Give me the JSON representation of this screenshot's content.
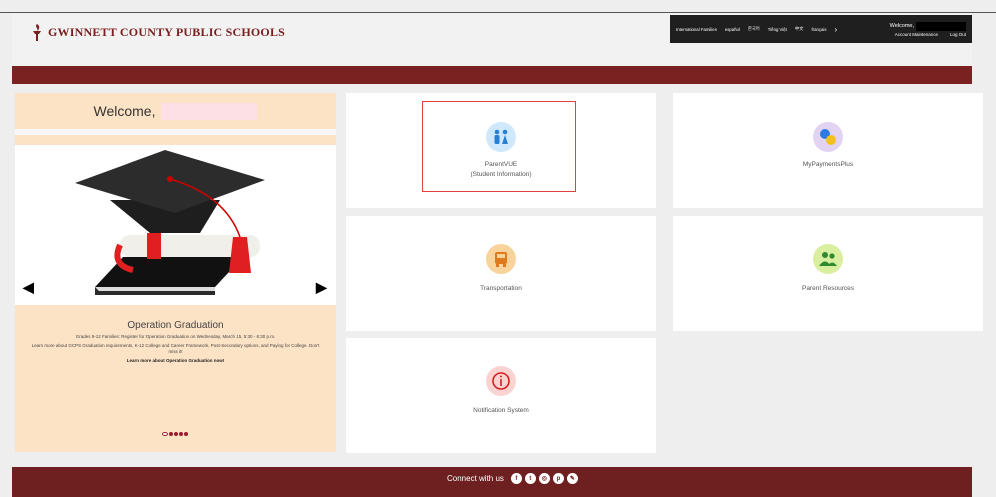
{
  "header": {
    "logo_text": "GWINNETT COUNTY PUBLIC SCHOOLS",
    "topbar": {
      "languages_label": "International Families",
      "languages": [
        "español",
        "한국어",
        "Tiếng Việt",
        "中文",
        "français"
      ],
      "welcome": "Welcome,",
      "account_maintenance": "Account Maintenance",
      "logout": "Log Out"
    }
  },
  "welcome": {
    "text": "Welcome,"
  },
  "carousel": {
    "title": "Operation Graduation",
    "line1": "Grades 9-12 Families: Register for Operation Graduation on Wednesday, March 15, 5:30 - 6:30 p.m.",
    "line2": "Learn more about GCPS Graduation requirements, K-12 College and Career Framework, Post-Secondary options, and Paying for College. Don't miss it!",
    "link": "Learn more about Operation Graduation now!",
    "slide_count": 5,
    "active_slide": 1
  },
  "cards": [
    {
      "line1": "ParentVUE",
      "line2": "(Student Information)",
      "icon": "parents-icon"
    },
    {
      "line1": "MyPaymentsPlus",
      "line2": "",
      "icon": "payments-icon"
    },
    {
      "line1": "Transportation",
      "line2": "",
      "icon": "bus-icon"
    },
    {
      "line1": "Parent Resources",
      "line2": "",
      "icon": "group-icon"
    },
    {
      "line1": "Notification System",
      "line2": "",
      "icon": "info-icon"
    }
  ],
  "footer": {
    "connect": "Connect with us",
    "social": [
      "facebook-icon",
      "twitter-icon",
      "instagram-icon",
      "pinterest-icon",
      "link-icon"
    ]
  },
  "colors": {
    "maroon": "#7a2222",
    "panel": "#fde3c5",
    "highlight": "#e04040"
  }
}
